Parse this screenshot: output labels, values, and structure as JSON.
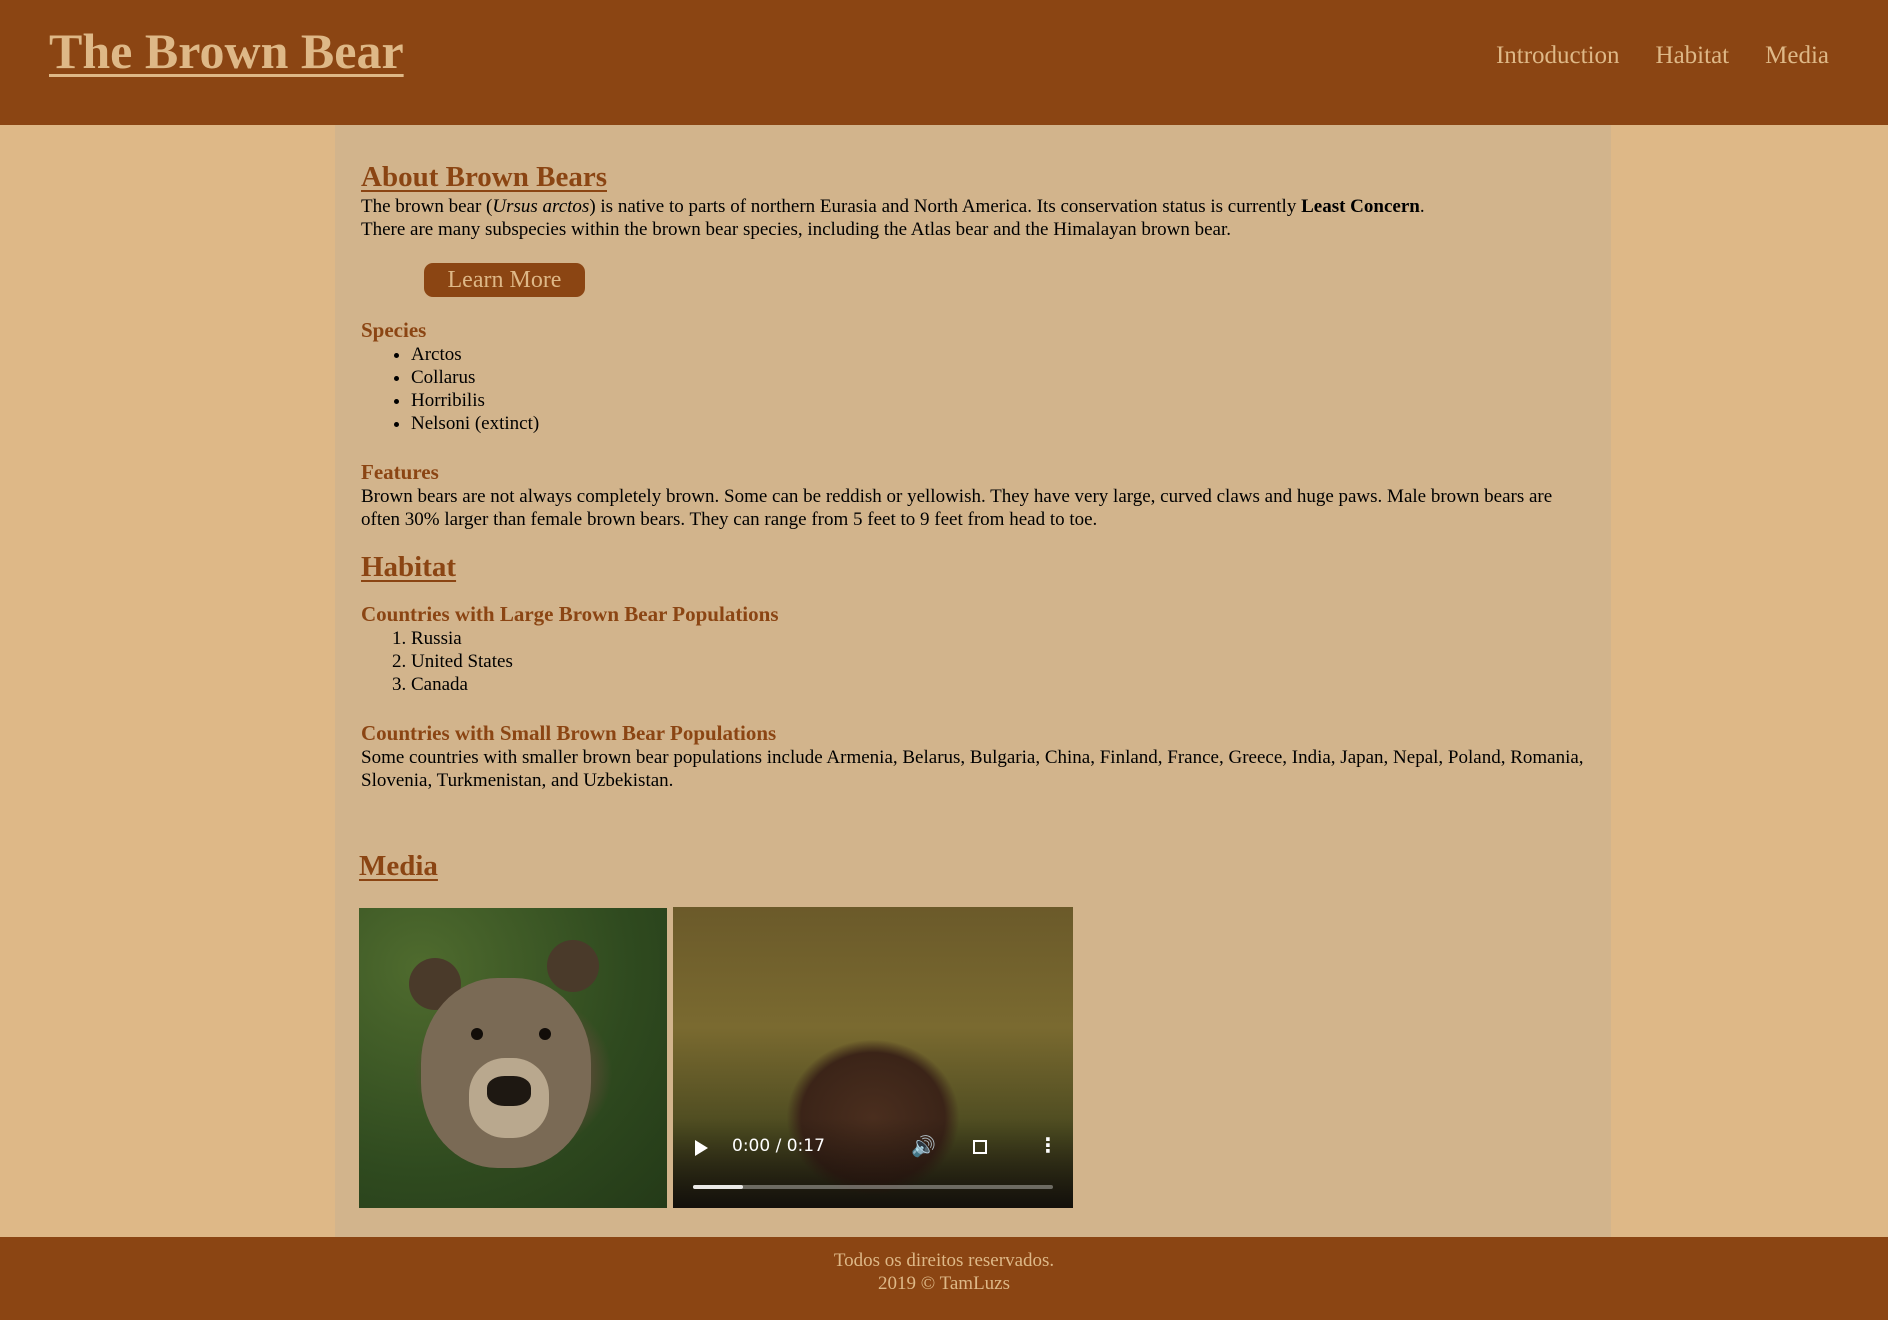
{
  "header": {
    "title": "The Brown Bear",
    "nav": [
      "Introduction",
      "Habitat",
      "Media"
    ]
  },
  "about": {
    "heading": "About Brown Bears",
    "p1_a": "The brown bear (",
    "p1_italic": "Ursus arctos",
    "p1_b": ") is native to parts of northern Eurasia and North America. Its conservation status is currently ",
    "p1_bold": "Least Concern",
    "p1_c": ".",
    "p2": "There are many subspecies within the brown bear species, including the Atlas bear and the Himalayan brown bear.",
    "button": "Learn More",
    "species_heading": "Species",
    "species": [
      "Arctos",
      "Collarus",
      "Horribilis",
      "Nelsoni (extinct)"
    ],
    "features_heading": "Features",
    "features_text": "Brown bears are not always completely brown. Some can be reddish or yellowish. They have very large, curved claws and huge paws. Male brown bears are often 30% larger than female brown bears. They can range from 5 feet to 9 feet from head to toe."
  },
  "habitat": {
    "heading": "Habitat",
    "large_heading": "Countries with Large Brown Bear Populations",
    "large": [
      "Russia",
      "United States",
      "Canada"
    ],
    "small_heading": "Countries with Small Brown Bear Populations",
    "small_text": "Some countries with smaller brown bear populations include Armenia, Belarus, Bulgaria, China, Finland, France, Greece, India, Japan, Nepal, Poland, Romania, Slovenia, Turkmenistan, and Uzbekistan."
  },
  "media": {
    "heading": "Media",
    "video": {
      "time": "0:00 / 0:17",
      "progress_fraction": 0.14
    },
    "icons": [
      "play-icon",
      "volume-icon",
      "fullscreen-icon",
      "more-options-icon"
    ]
  },
  "footer": {
    "line1": "Todos os direitos reservados.",
    "line2": "2019 © TamLuzs"
  },
  "colors": {
    "header_bg": "#8b4513",
    "page_bg": "#deb887",
    "panel_bg": "#d2b48c",
    "accent": "#8b4513",
    "header_text": "#deb887"
  }
}
